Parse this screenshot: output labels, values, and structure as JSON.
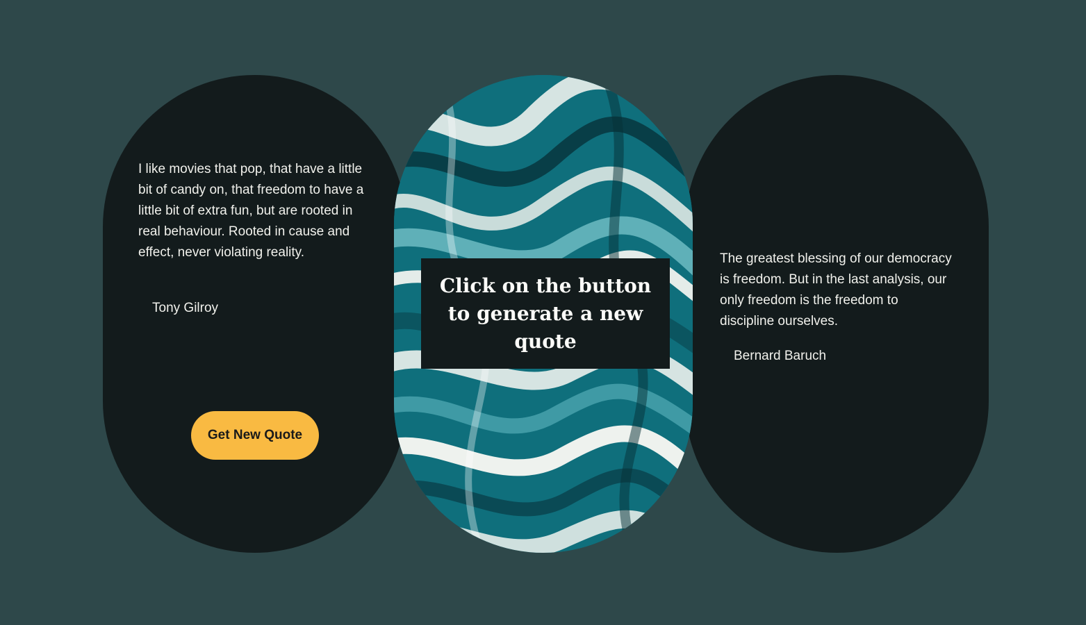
{
  "left_card": {
    "quote": "I like movies that pop, that have a little bit of candy on, that freedom to have a little bit of extra fun, but are rooted in real behaviour. Rooted in cause and effect, never violating reality.",
    "author": "Tony Gilroy",
    "button_label": "Get New Quote"
  },
  "center_card": {
    "prompt_line1": "Click on the button",
    "prompt_line2": "to generate a new quote"
  },
  "right_card": {
    "quote": "The greatest blessing of our democracy is freedom. But in the last analysis, our only freedom is the freedom to discipline ourselves.",
    "author": "Bernard Baruch"
  },
  "colors": {
    "background": "#2e484a",
    "card": "#131b1c",
    "button": "#f9ba42",
    "text": "#f1f1ec",
    "marble_teal": "#0f6f7c",
    "marble_light": "#d6e4e2"
  }
}
